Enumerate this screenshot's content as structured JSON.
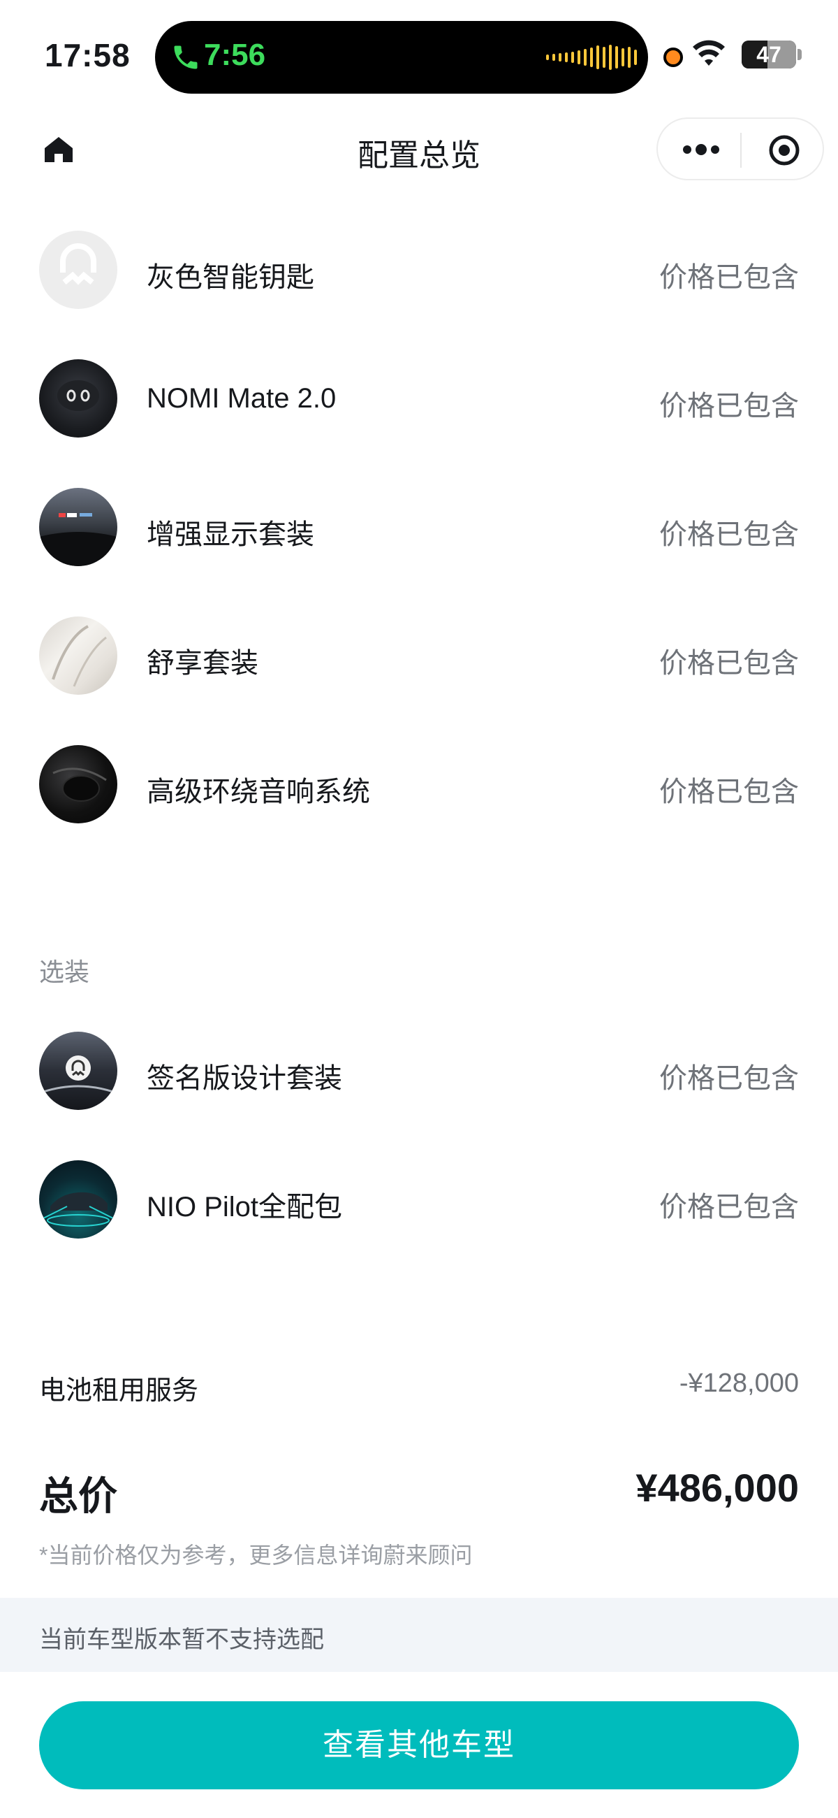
{
  "status_bar": {
    "time": "17:58",
    "call_time": "7:56",
    "battery_level": "47",
    "accent_call": "#3ddc5c",
    "accent_wave": "#ffc83a"
  },
  "nav": {
    "title": "配置总览",
    "home_icon": "home-icon",
    "more_icon": "more-dots-icon",
    "close_icon": "target-circle-icon"
  },
  "included_items": [
    {
      "name": "灰色智能钥匙",
      "price": "价格已包含",
      "icon": "nio-logo-thumb"
    },
    {
      "name": "NOMI Mate 2.0",
      "price": "价格已包含",
      "icon": "nomi-thumb"
    },
    {
      "name": "增强显示套装",
      "price": "价格已包含",
      "icon": "hud-thumb"
    },
    {
      "name": "舒享套装",
      "price": "价格已包含",
      "icon": "seat-thumb"
    },
    {
      "name": "高级环绕音响系统",
      "price": "价格已包含",
      "icon": "speaker-thumb"
    }
  ],
  "optional_section": {
    "label": "选装",
    "items": [
      {
        "name": "签名版设计套装",
        "price": "价格已包含",
        "icon": "signature-thumb"
      },
      {
        "name": "NIO Pilot全配包",
        "price": "价格已包含",
        "icon": "car-thumb"
      }
    ]
  },
  "battery_service": {
    "label": "电池租用服务",
    "value": "-¥128,000"
  },
  "total": {
    "label": "总价",
    "value": "¥486,000",
    "note": "*当前价格仅为参考，更多信息详询蔚来顾问"
  },
  "notice": "当前车型版本暂不支持选配",
  "cta": {
    "label": "查看其他车型",
    "color": "#00bcbc"
  }
}
